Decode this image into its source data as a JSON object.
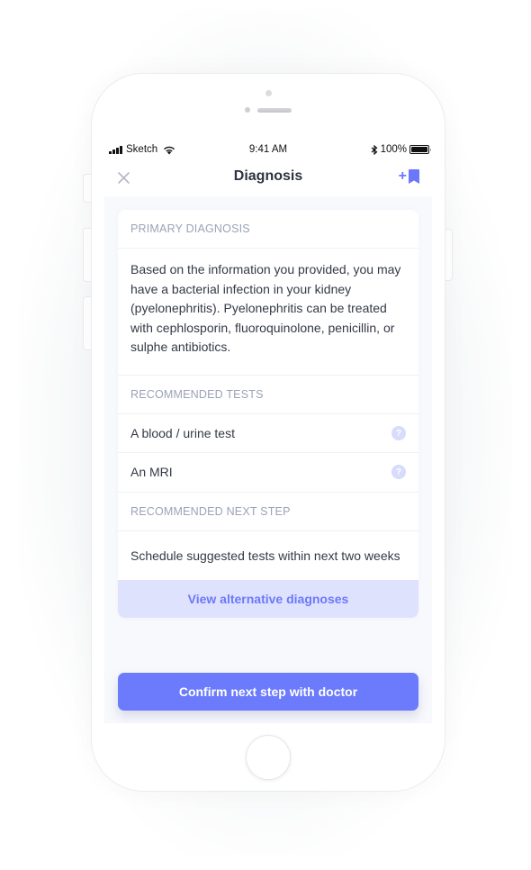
{
  "status_bar": {
    "carrier": "Sketch",
    "time": "9:41 AM",
    "battery_percent": "100%",
    "icons": [
      "signal-icon",
      "wifi-icon",
      "bluetooth-icon",
      "battery-icon"
    ]
  },
  "nav": {
    "title": "Diagnosis",
    "close_icon": "close-icon",
    "bookmark_plus": "+",
    "bookmark_icon": "bookmark-add-icon"
  },
  "card": {
    "primary_diagnosis": {
      "header": "PRIMARY DIAGNOSIS",
      "text": "Based on the information you provided, you may have a bacterial infection in your kidney (pyelonephritis). Pyelonephritis can be treated with cephlosporin, fluoroquinolone, penicillin, or sulphe antibiotics."
    },
    "recommended_tests": {
      "header": "RECOMMENDED TESTS",
      "items": [
        {
          "label": "A blood / urine test",
          "help": "?"
        },
        {
          "label": "An MRI",
          "help": "?"
        }
      ]
    },
    "recommended_next_step": {
      "header": "RECOMMENDED NEXT STEP",
      "text": "Schedule suggested tests within next two weeks"
    },
    "alternative_button": "View alternative diagnoses"
  },
  "confirm_button": "Confirm next step with doctor",
  "colors": {
    "accent": "#6b7bfb",
    "accent_light": "#dfe2fd",
    "help_icon": "#d7dbfc",
    "section_header_text": "#9ca2b8",
    "body_text": "#343946",
    "screen_background": "#f8f9fd"
  }
}
